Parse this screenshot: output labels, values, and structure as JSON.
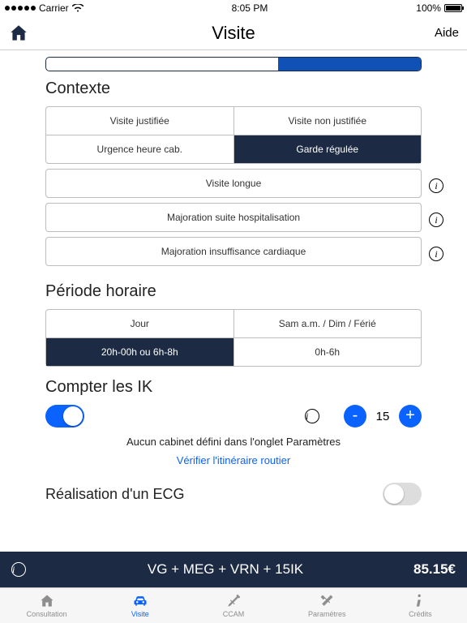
{
  "status": {
    "carrier": "Carrier",
    "time": "8:05 PM",
    "battery": "100%"
  },
  "nav": {
    "title": "Visite",
    "help": "Aide"
  },
  "sections": {
    "context": "Contexte",
    "period": "Période horaire",
    "ik": "Compter les IK",
    "ecg": "Réalisation d'un ECG"
  },
  "context": {
    "row1": {
      "a": "Visite justifiée",
      "b": "Visite non justifiée"
    },
    "row2": {
      "a": "Urgence heure cab.",
      "b": "Garde régulée"
    },
    "long": "Visite longue",
    "hosp": "Majoration suite hospitalisation",
    "cardiac": "Majoration insuffisance cardiaque"
  },
  "period": {
    "row1": {
      "a": "Jour",
      "b": "Sam a.m. / Dim / Férié"
    },
    "row2": {
      "a": "20h-00h ou 6h-8h",
      "b": "0h-6h"
    }
  },
  "ik": {
    "enabled": true,
    "value": "15",
    "minus": "-",
    "plus": "+"
  },
  "messages": {
    "no_cabinet": "Aucun cabinet défini dans l'onglet Paramètres",
    "verify_route": "Vérifier l'itinéraire routier"
  },
  "summary": {
    "formula": "VG + MEG + VRN + 15IK",
    "price": "85.15€"
  },
  "tabs": {
    "consultation": "Consultation",
    "visite": "Visite",
    "ccam": "CCAM",
    "parametres": "Paramètres",
    "credits": "Crédits"
  },
  "icons": {
    "home": "home-icon",
    "info": "info-icon",
    "minus": "minus-icon",
    "plus": "plus-icon",
    "car": "car-icon",
    "syringe": "syringe-icon",
    "tools": "tools-icon",
    "i": "info-italic-icon"
  },
  "colors": {
    "accent": "#0a62ff",
    "dark": "#1c2a44"
  }
}
